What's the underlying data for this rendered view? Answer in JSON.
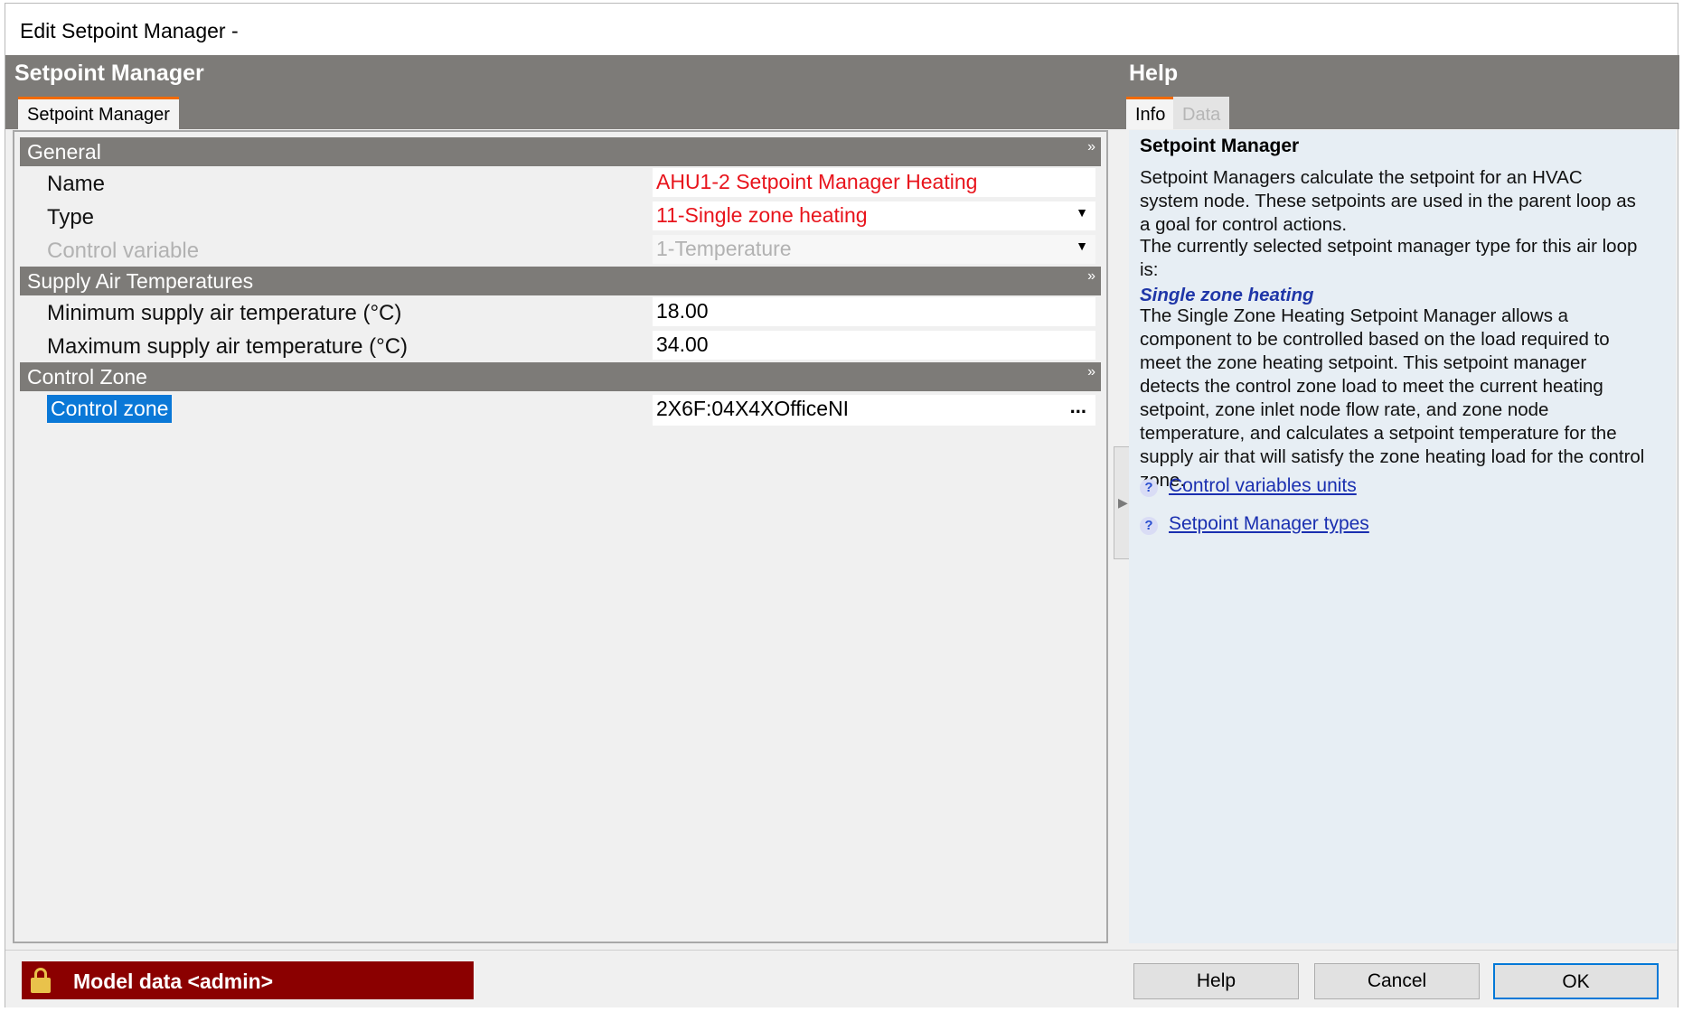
{
  "window": {
    "title": "Edit Setpoint Manager -"
  },
  "left_panel": {
    "header": "Setpoint Manager",
    "tab": "Setpoint Manager",
    "sections": [
      {
        "title": "General",
        "rows": [
          {
            "label": "Name",
            "value": "AHU1-2 Setpoint Manager Heating",
            "style": "red",
            "control": "text"
          },
          {
            "label": "Type",
            "value": "11-Single zone heating",
            "style": "red",
            "control": "dropdown"
          },
          {
            "label": "Control variable",
            "value": "1-Temperature",
            "style": "disabled",
            "control": "dropdown"
          }
        ]
      },
      {
        "title": "Supply Air Temperatures",
        "rows": [
          {
            "label": "Minimum supply air temperature (°C)",
            "value": "18.00",
            "style": "normal",
            "control": "text"
          },
          {
            "label": "Maximum supply air temperature (°C)",
            "value": "34.00",
            "style": "normal",
            "control": "text"
          }
        ]
      },
      {
        "title": "Control Zone",
        "rows": [
          {
            "label": "Control zone",
            "value": "2X6F:04X4XOfficeNI",
            "style": "selected",
            "control": "browse"
          }
        ]
      }
    ],
    "ellipsis": "...",
    "dropdown_arrow": "▼"
  },
  "help_panel": {
    "header": "Help",
    "tabs": [
      "Info",
      "Data"
    ],
    "title": "Setpoint Manager",
    "para1": "Setpoint Managers calculate the setpoint for an HVAC system node. These setpoints are used in the parent loop as a goal for control actions.",
    "para2": "The currently selected setpoint manager type for this air loop is:",
    "subtitle": "Single zone heating",
    "para3": "The Single Zone Heating Setpoint Manager allows a component to be controlled based on the load required to meet the zone heating setpoint. This setpoint manager detects the control zone load to meet the current heating setpoint, zone inlet node flow rate, and zone node temperature, and calculates a setpoint temperature for the supply air that will satisfy the zone heating load for the control zone.",
    "links": [
      "Control variables units",
      "Setpoint Manager types"
    ]
  },
  "footer": {
    "status": "Model data <admin>",
    "buttons": {
      "help": "Help",
      "cancel": "Cancel",
      "ok": "OK"
    }
  },
  "colors": {
    "header_gray": "#7d7b78",
    "tab_accent": "#f26a00",
    "invalid_red": "#e8141c",
    "status_red": "#8b0000",
    "selection_blue": "#0a78d7",
    "link_blue": "#1a2fb0"
  }
}
